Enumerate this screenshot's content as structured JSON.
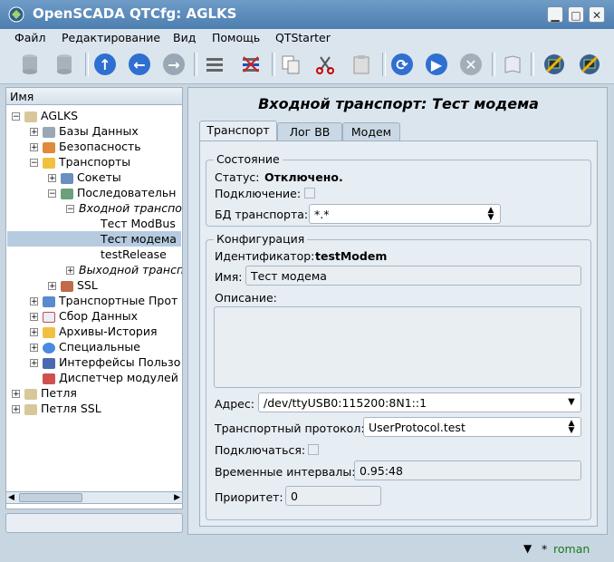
{
  "window": {
    "title": "OpenSCADA QTCfg: AGLKS"
  },
  "menu": [
    {
      "label": "Файл"
    },
    {
      "label": "Редактирование"
    },
    {
      "label": "Вид"
    },
    {
      "label": "Помощь"
    },
    {
      "label": "QTStarter"
    }
  ],
  "toolbar_icons": [
    "database-load-icon",
    "database-save-icon",
    "up-icon",
    "back-icon",
    "forward-icon",
    "add-item-icon",
    "delete-item-icon",
    "copy-icon",
    "cut-icon",
    "paste-icon",
    "reload-icon",
    "start-icon",
    "stop-icon",
    "manual-icon",
    "qtcfg-icon",
    "uiproc-icon"
  ],
  "tree": {
    "header": "Имя",
    "items": [
      {
        "label": "AGLKS"
      },
      {
        "label": "Базы Данных"
      },
      {
        "label": "Безопасность"
      },
      {
        "label": "Транспорты"
      },
      {
        "label": "Сокеты"
      },
      {
        "label": "Последовательн"
      },
      {
        "label": "Входной транспо"
      },
      {
        "label": "Тест ModBus"
      },
      {
        "label": "Тест модема"
      },
      {
        "label": "testRelease"
      },
      {
        "label": "Выходной трансп"
      },
      {
        "label": "SSL"
      },
      {
        "label": "Транспортные Прот"
      },
      {
        "label": "Сбор Данных"
      },
      {
        "label": "Архивы-История"
      },
      {
        "label": "Специальные"
      },
      {
        "label": "Интерфейсы Пользо"
      },
      {
        "label": "Диспетчер модулей"
      },
      {
        "label": "Петля"
      },
      {
        "label": "Петля SSL"
      }
    ]
  },
  "page": {
    "title": "Входной транспорт: Тест модема",
    "tabs": [
      "Транспорт",
      "Лог ВВ",
      "Модем"
    ],
    "state": {
      "group_title": "Состояние",
      "status_label": "Статус:",
      "status_value": "Отключено.",
      "connection_label": "Подключение:",
      "db_label": "БД транспорта:",
      "db_value": "*.*"
    },
    "config": {
      "group_title": "Конфигурация",
      "id_label": "Идентификатор:",
      "id_value": "testModem",
      "name_label": "Имя:",
      "name_value": "Тест модема",
      "desc_label": "Описание:",
      "desc_value": "",
      "address_label": "Адрес:",
      "address_value": "/dev/ttyUSB0:115200:8N1::1",
      "protocol_label": "Транспортный протокол:",
      "protocol_value": "UserProtocol.test",
      "autostart_label": "Подключаться:",
      "timings_label": "Временные интервалы:",
      "timings_value": "0.95:48",
      "priority_label": "Приоритет:",
      "priority_value": "0"
    }
  },
  "status_bar": {
    "user": "roman",
    "marker": "*"
  }
}
